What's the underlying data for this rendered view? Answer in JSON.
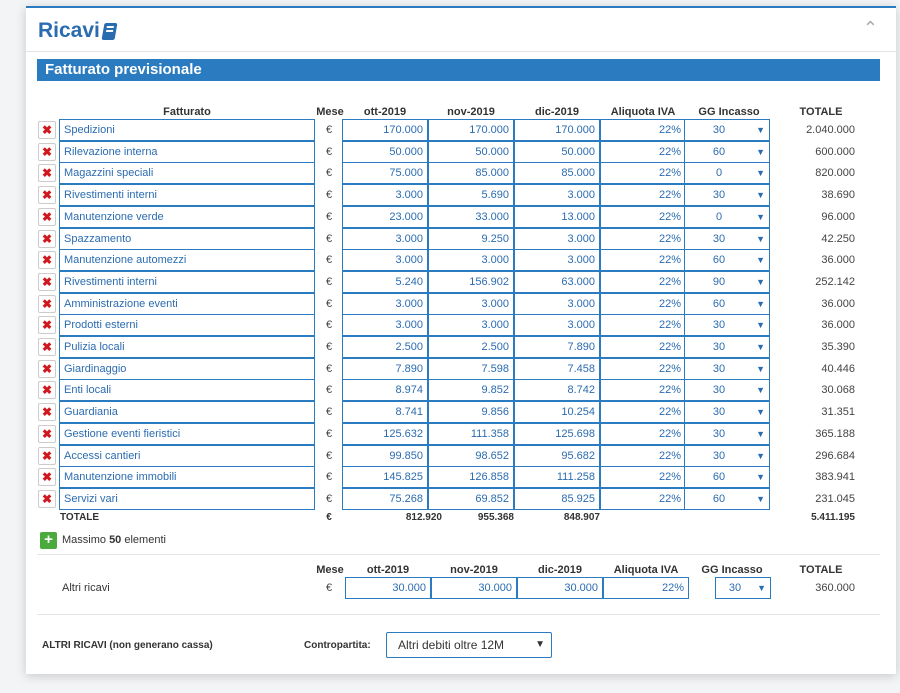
{
  "panel": {
    "title": "Ricavi",
    "book_icon": "book-icon",
    "collapse_icon": "chevron-up-icon"
  },
  "section_title": "Fatturato previsionale",
  "columns": {
    "fatturato": "Fatturato",
    "mese": "Mese",
    "m1": "ott-2019",
    "m2": "nov-2019",
    "m3": "dic-2019",
    "iva": "Aliquota IVA",
    "gg": "GG Incasso",
    "totale": "TOTALE"
  },
  "currency": "€",
  "rows": [
    {
      "name": "Spedizioni",
      "m1": "170.000",
      "m2": "170.000",
      "m3": "170.000",
      "iva": "22%",
      "gg": "30",
      "total": "2.040.000"
    },
    {
      "name": "Rilevazione interna",
      "m1": "50.000",
      "m2": "50.000",
      "m3": "50.000",
      "iva": "22%",
      "gg": "60",
      "total": "600.000"
    },
    {
      "name": "Magazzini speciali",
      "m1": "75.000",
      "m2": "85.000",
      "m3": "85.000",
      "iva": "22%",
      "gg": "0",
      "total": "820.000"
    },
    {
      "name": "Rivestimenti interni",
      "m1": "3.000",
      "m2": "5.690",
      "m3": "3.000",
      "iva": "22%",
      "gg": "30",
      "total": "38.690"
    },
    {
      "name": "Manutenzione verde",
      "m1": "23.000",
      "m2": "33.000",
      "m3": "13.000",
      "iva": "22%",
      "gg": "0",
      "total": "96.000"
    },
    {
      "name": "Spazzamento",
      "m1": "3.000",
      "m2": "9.250",
      "m3": "3.000",
      "iva": "22%",
      "gg": "30",
      "total": "42.250"
    },
    {
      "name": "Manutenzione automezzi",
      "m1": "3.000",
      "m2": "3.000",
      "m3": "3.000",
      "iva": "22%",
      "gg": "60",
      "total": "36.000"
    },
    {
      "name": "Rivestimenti interni",
      "m1": "5.240",
      "m2": "156.902",
      "m3": "63.000",
      "iva": "22%",
      "gg": "90",
      "total": "252.142"
    },
    {
      "name": "Amministrazione eventi",
      "m1": "3.000",
      "m2": "3.000",
      "m3": "3.000",
      "iva": "22%",
      "gg": "60",
      "total": "36.000"
    },
    {
      "name": "Prodotti esterni",
      "m1": "3.000",
      "m2": "3.000",
      "m3": "3.000",
      "iva": "22%",
      "gg": "30",
      "total": "36.000"
    },
    {
      "name": "Pulizia locali",
      "m1": "2.500",
      "m2": "2.500",
      "m3": "7.890",
      "iva": "22%",
      "gg": "30",
      "total": "35.390"
    },
    {
      "name": "Giardinaggio",
      "m1": "7.890",
      "m2": "7.598",
      "m3": "7.458",
      "iva": "22%",
      "gg": "30",
      "total": "40.446"
    },
    {
      "name": "Enti locali",
      "m1": "8.974",
      "m2": "9.852",
      "m3": "8.742",
      "iva": "22%",
      "gg": "30",
      "total": "30.068"
    },
    {
      "name": "Guardiania",
      "m1": "8.741",
      "m2": "9.856",
      "m3": "10.254",
      "iva": "22%",
      "gg": "30",
      "total": "31.351"
    },
    {
      "name": "Gestione eventi fieristici",
      "m1": "125.632",
      "m2": "111.358",
      "m3": "125.698",
      "iva": "22%",
      "gg": "30",
      "total": "365.188"
    },
    {
      "name": "Accessi cantieri",
      "m1": "99.850",
      "m2": "98.652",
      "m3": "95.682",
      "iva": "22%",
      "gg": "30",
      "total": "296.684"
    },
    {
      "name": "Manutenzione immobili",
      "m1": "145.825",
      "m2": "126.858",
      "m3": "111.258",
      "iva": "22%",
      "gg": "60",
      "total": "383.941"
    },
    {
      "name": "Servizi vari",
      "m1": "75.268",
      "m2": "69.852",
      "m3": "85.925",
      "iva": "22%",
      "gg": "60",
      "total": "231.045"
    }
  ],
  "totals": {
    "label": "TOTALE",
    "currency": "€",
    "m1": "812.920",
    "m2": "955.368",
    "m3": "848.907",
    "total": "5.411.195"
  },
  "add": {
    "prefix": "Massimo ",
    "count": "50",
    "suffix": " elementi"
  },
  "altri": {
    "label": "Altri ricavi",
    "currency": "€",
    "m1": "30.000",
    "m2": "30.000",
    "m3": "30.000",
    "iva": "22%",
    "gg": "30",
    "total": "360.000"
  },
  "footer": {
    "label": "ALTRI RICAVI (non generano cassa)",
    "contropartita_label": "Contropartita:",
    "contropartita_value": "Altri debiti oltre 12M"
  }
}
